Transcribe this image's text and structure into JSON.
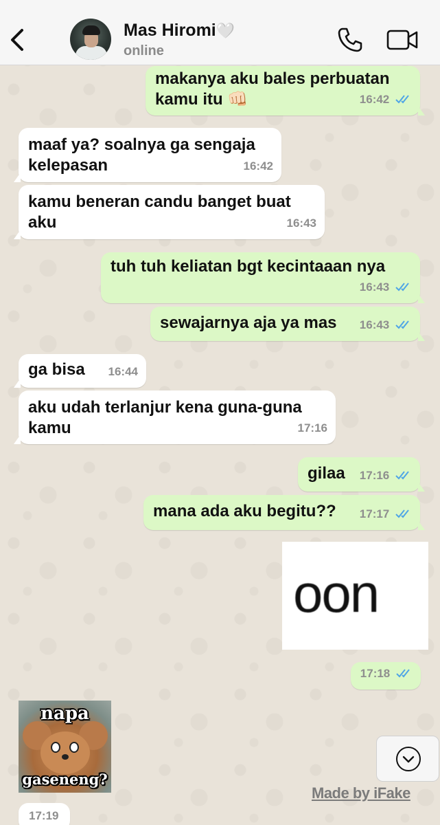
{
  "header": {
    "contact_name": "Mas Hiromi",
    "heart": "🤍",
    "status": "online"
  },
  "messages": [
    {
      "side": "out",
      "text": "makanya aku bales perbuatan kamu itu 👊🏻",
      "time": "16:42",
      "read": true
    },
    {
      "side": "in",
      "text": "maaf ya? soalnya ga sengaja kelepasan",
      "time": "16:42"
    },
    {
      "side": "in",
      "text": "kamu beneran candu banget buat aku",
      "time": "16:43"
    },
    {
      "side": "out",
      "text": "tuh tuh keliatan bgt kecintaaan nya",
      "time": "16:43",
      "read": true
    },
    {
      "side": "out",
      "text": "sewajarnya aja ya mas",
      "time": "16:43",
      "read": true
    },
    {
      "side": "in",
      "text": "ga bisa",
      "time": "16:44"
    },
    {
      "side": "in",
      "text": "aku udah terlanjur kena guna-guna kamu",
      "time": "17:16"
    },
    {
      "side": "out",
      "text": "gilaa",
      "time": "17:16",
      "read": true
    },
    {
      "side": "out",
      "text": "mana ada aku begitu??",
      "time": "17:17",
      "read": true
    },
    {
      "side": "out",
      "type": "sticker",
      "sticker_text": "oon",
      "time": "17:18",
      "read": true
    },
    {
      "side": "in",
      "type": "sticker",
      "sticker_top": "napa",
      "sticker_bottom": "gaseneng?",
      "time": "17:19"
    }
  ],
  "watermark": "Made by iFake",
  "colors": {
    "outgoing_bubble": "#dcf8c6",
    "incoming_bubble": "#ffffff",
    "read_ticks": "#4fa5e6",
    "header_bg": "#f6f6f6"
  },
  "icons": [
    "back-chevron-icon",
    "phone-icon",
    "video-camera-icon",
    "chevron-down-icon",
    "double-check-icon"
  ]
}
